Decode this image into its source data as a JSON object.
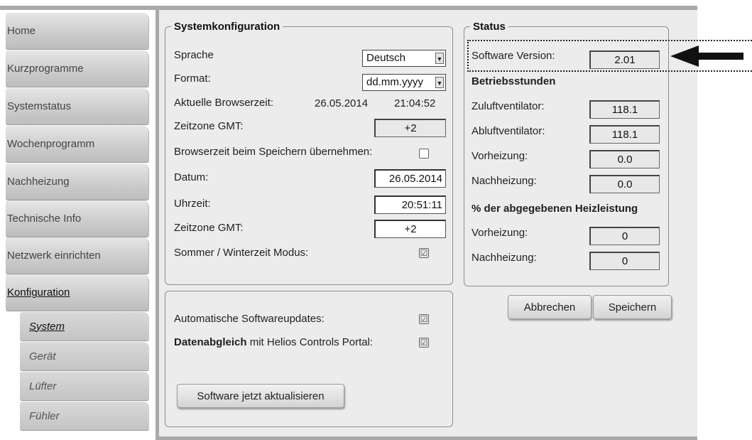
{
  "sidebar": {
    "items": [
      {
        "label": "Home"
      },
      {
        "label": "Kurzprogramme"
      },
      {
        "label": "Systemstatus"
      },
      {
        "label": "Wochenprogramm"
      },
      {
        "label": "Nachheizung"
      },
      {
        "label": "Technische Info"
      },
      {
        "label": "Netzwerk einrichten"
      },
      {
        "label": "Konfiguration"
      }
    ],
    "subitems": [
      {
        "label": "System"
      },
      {
        "label": "Gerät"
      },
      {
        "label": "Lüfter"
      },
      {
        "label": "Fühler"
      }
    ]
  },
  "system": {
    "legend": "Systemkonfiguration",
    "sprache_label": "Sprache",
    "sprache_value": "Deutsch",
    "format_label": "Format:",
    "format_value": "dd.mm.yyyy",
    "browserzeit_label": "Aktuelle Browserzeit:",
    "browserzeit_date": "26.05.2014",
    "browserzeit_time": "21:04:52",
    "zeitzone1_label": "Zeitzone GMT:",
    "zeitzone1_value": "+2",
    "uebernehmen_label": "Browserzeit beim Speichern übernehmen:",
    "datum_label": "Datum:",
    "datum_value": "26.05.2014",
    "uhrzeit_label": "Uhrzeit:",
    "uhrzeit_value": "20:51:11",
    "zeitzone2_label": "Zeitzone GMT:",
    "zeitzone2_value": "+2",
    "sommer_label": "Sommer / Winterzeit Modus:",
    "check_mark": "☑"
  },
  "updates": {
    "auto_label": "Automatische Softwareupdates:",
    "sync_label_bold": "Datenabgleich",
    "sync_label_rest": " mit Helios Controls Portal:",
    "update_button": "Software jetzt aktualisieren"
  },
  "status": {
    "legend": "Status",
    "software_label": "Software Version:",
    "software_value": "2.01",
    "betrieb_heading": "Betriebsstunden",
    "zuluft_label": "Zuluftventilator:",
    "zuluft_value": "118.1",
    "abluft_label": "Abluftventilator:",
    "abluft_value": "118.1",
    "vorheiz1_label": "Vorheizung:",
    "vorheiz1_value": "0.0",
    "nachheiz1_label": "Nachheizung:",
    "nachheiz1_value": "0.0",
    "heizleistung_heading": "% der abgegebenen Heizleistung",
    "vorheiz2_label": "Vorheizung:",
    "vorheiz2_value": "0",
    "nachheiz2_label": "Nachheizung:",
    "nachheiz2_value": "0"
  },
  "actions": {
    "cancel": "Abbrechen",
    "save": "Speichern"
  }
}
